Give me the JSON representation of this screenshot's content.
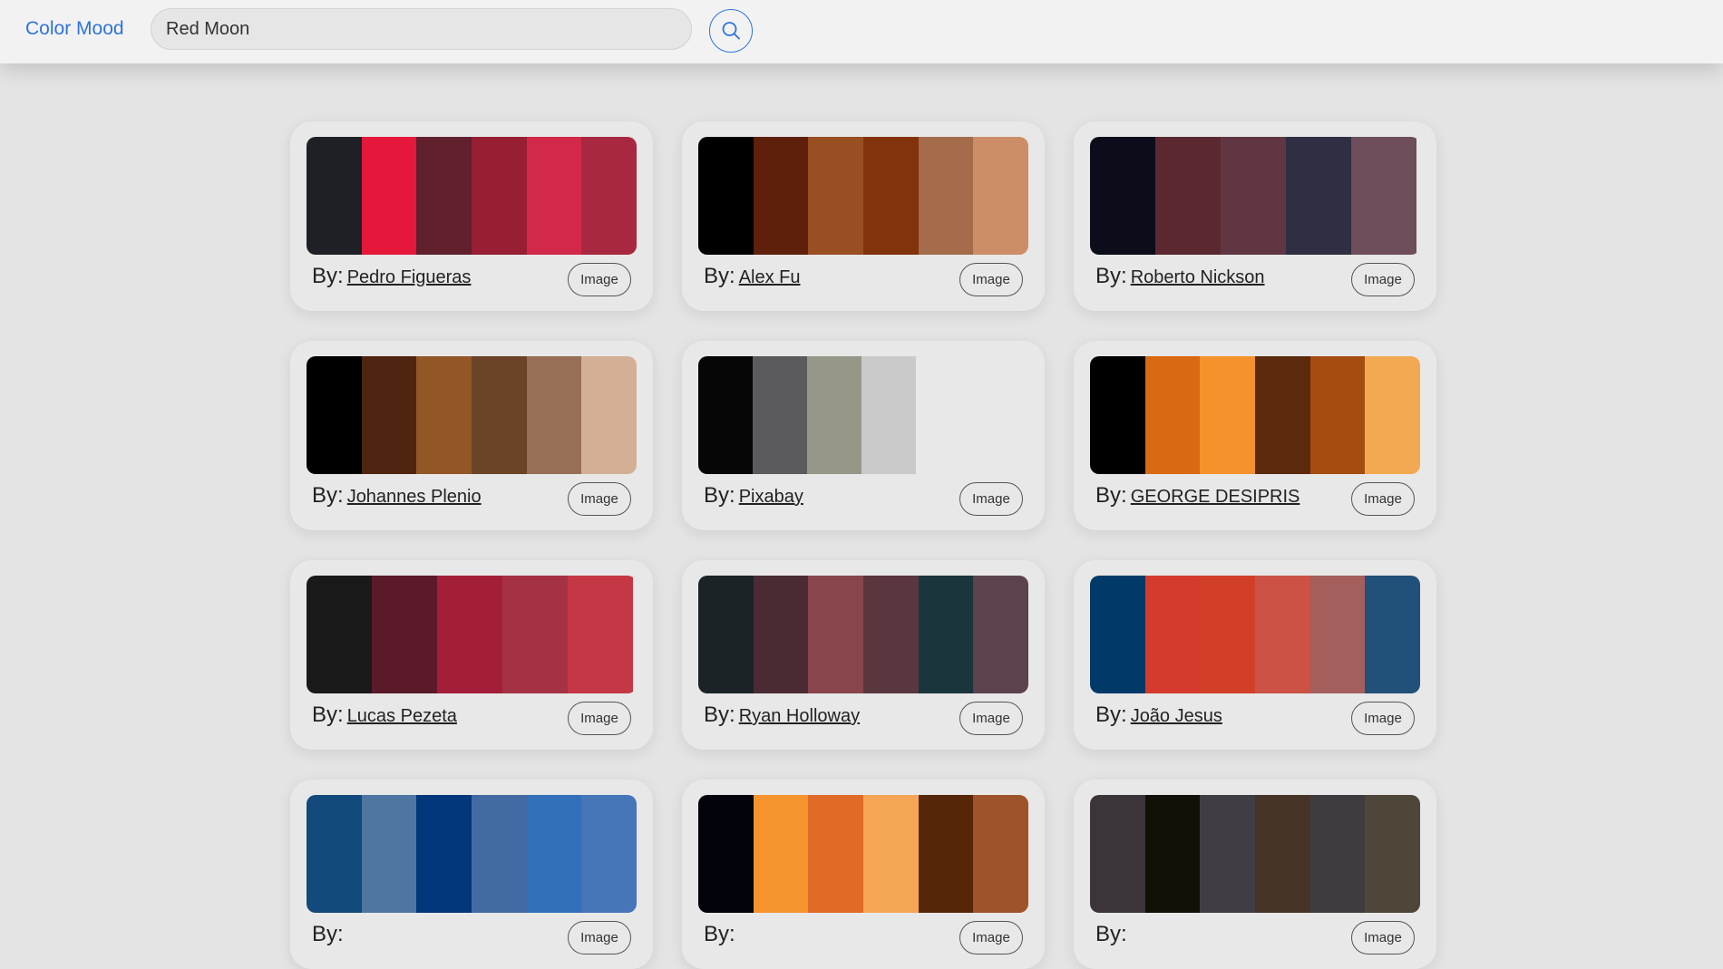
{
  "header": {
    "brand": "Color Mood",
    "search_value": "Red Moon",
    "search_icon": "search-icon"
  },
  "by_label": "By:",
  "image_button_label": "Image",
  "cards": [
    {
      "author": "Pedro Figueras",
      "colors": [
        "#1e2025",
        "#e5173a",
        "#60202e",
        "#981e33",
        "#d2284a",
        "#a72840"
      ]
    },
    {
      "author": "Alex Fu",
      "colors": [
        "#000000",
        "#5f200b",
        "#994f21",
        "#82330c",
        "#a46c4a",
        "#cd8e67"
      ]
    },
    {
      "author": "Roberto Nickson",
      "colors": [
        "#0b0d1b",
        "#5b2832",
        "#603643",
        "#2f2e42",
        "#6d4e5a"
      ]
    },
    {
      "author": "Johannes Plenio",
      "colors": [
        "#000000",
        "#4f2410",
        "#935726",
        "#6b4328",
        "#976f56",
        "#d3b095"
      ]
    },
    {
      "author": "Pixabay",
      "colors": [
        "#060606",
        "#5b5a5c",
        "#969789",
        "#cacaca"
      ]
    },
    {
      "author": "GEORGE DESIPRIS",
      "colors": [
        "#000000",
        "#d96912",
        "#f5922b",
        "#5c2a0c",
        "#a54c11",
        "#f3a951"
      ]
    },
    {
      "author": "Lucas Pezeta",
      "colors": [
        "#191919",
        "#5b1a29",
        "#a31f39",
        "#a43144",
        "#c53745"
      ]
    },
    {
      "author": "Ryan Holloway",
      "colors": [
        "#1b2326",
        "#4a2b33",
        "#88454b",
        "#5a363e",
        "#1b353c",
        "#5c424d"
      ]
    },
    {
      "author": "João Jesus",
      "colors": [
        "#013a68",
        "#d53b2d",
        "#d23f28",
        "#cb5245",
        "#a45e5c",
        "#215079"
      ]
    },
    {
      "author": "",
      "colors": [
        "#124a7b",
        "#4e76a0",
        "#02377b",
        "#426aa3",
        "#3270ba",
        "#4676b8"
      ]
    },
    {
      "author": "",
      "colors": [
        "#03040b",
        "#f5942f",
        "#e06b29",
        "#f4a556",
        "#562609",
        "#9e532b"
      ]
    },
    {
      "author": "",
      "colors": [
        "#3b3439",
        "#121108",
        "#403e44",
        "#463429",
        "#3e3c3f",
        "#4f463a"
      ]
    }
  ]
}
